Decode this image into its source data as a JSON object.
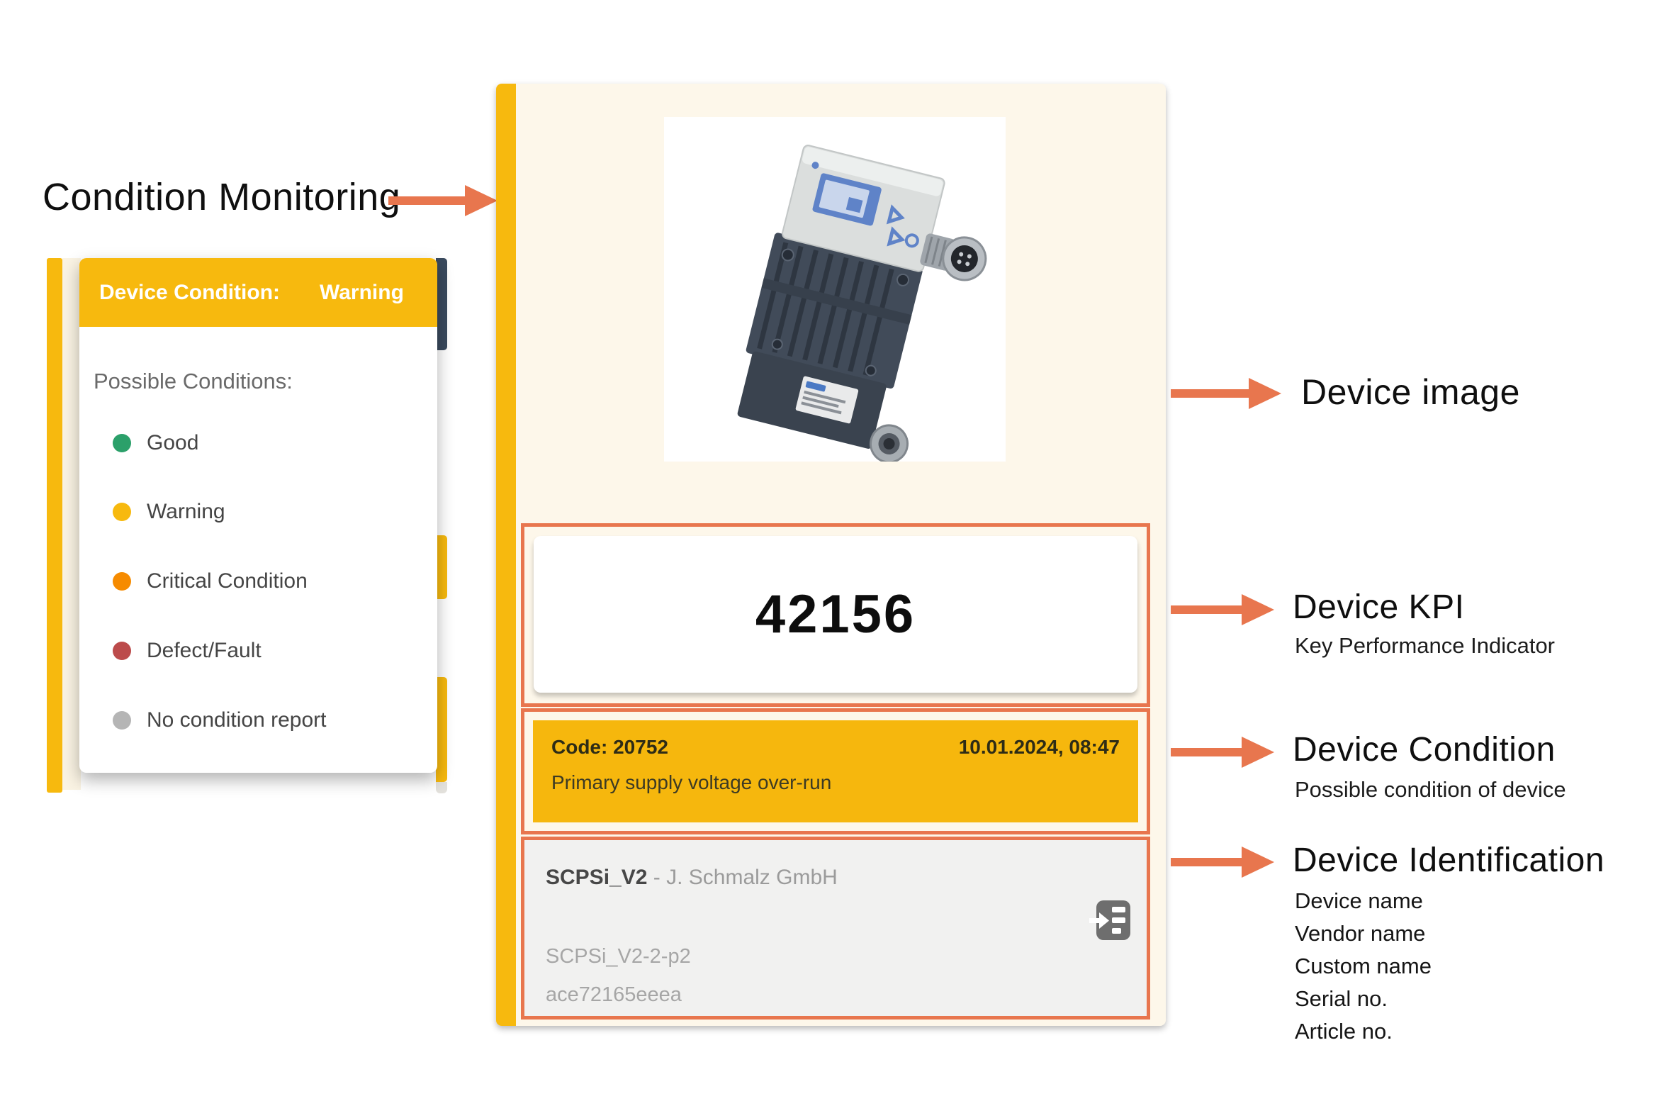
{
  "colors": {
    "accent_orange": "#E8764E",
    "warning_yellow": "#F7B90E",
    "condition_row_yellow": "#F6B70D",
    "card_background": "#FDF7EA",
    "identification_background": "#F1F1F0",
    "hidden_card_navy": "#3A4A5E"
  },
  "left_annotation": {
    "label": "Condition Monitoring"
  },
  "popup": {
    "header_label": "Device Condition:",
    "header_value": "Warning",
    "body_title": "Possible Conditions:",
    "conditions": [
      {
        "label": "Good",
        "color": "#2BA06A"
      },
      {
        "label": "Warning",
        "color": "#F7B90E"
      },
      {
        "label": "Critical Condition",
        "color": "#F68B00"
      },
      {
        "label": "Defect/Fault",
        "color": "#BC4B4B"
      },
      {
        "label": "No condition report",
        "color": "#B5B5B5"
      }
    ]
  },
  "device_card": {
    "kpi": {
      "value": "42156"
    },
    "condition": {
      "code": "Code: 20752",
      "timestamp": "10.01.2024, 08:47",
      "message": "Primary supply voltage over-run"
    },
    "identification": {
      "device_name": "SCPSi_V2",
      "separator": " - ",
      "vendor_name": "J. Schmalz GmbH",
      "serial_no": "SCPSi_V2-2-p2",
      "article_no": "ace72165eeea",
      "icon": "goto-device-icon"
    }
  },
  "right_annotations": {
    "image": {
      "title": "Device image"
    },
    "kpi": {
      "title": "Device KPI",
      "subtitle": "Key Performance Indicator"
    },
    "condition": {
      "title": "Device Condition",
      "subtitle": "Possible condition of device"
    },
    "identification": {
      "title": "Device Identification",
      "lines": [
        "Device name",
        "Vendor name",
        "Custom name",
        "Serial no.",
        "Article no."
      ]
    }
  }
}
